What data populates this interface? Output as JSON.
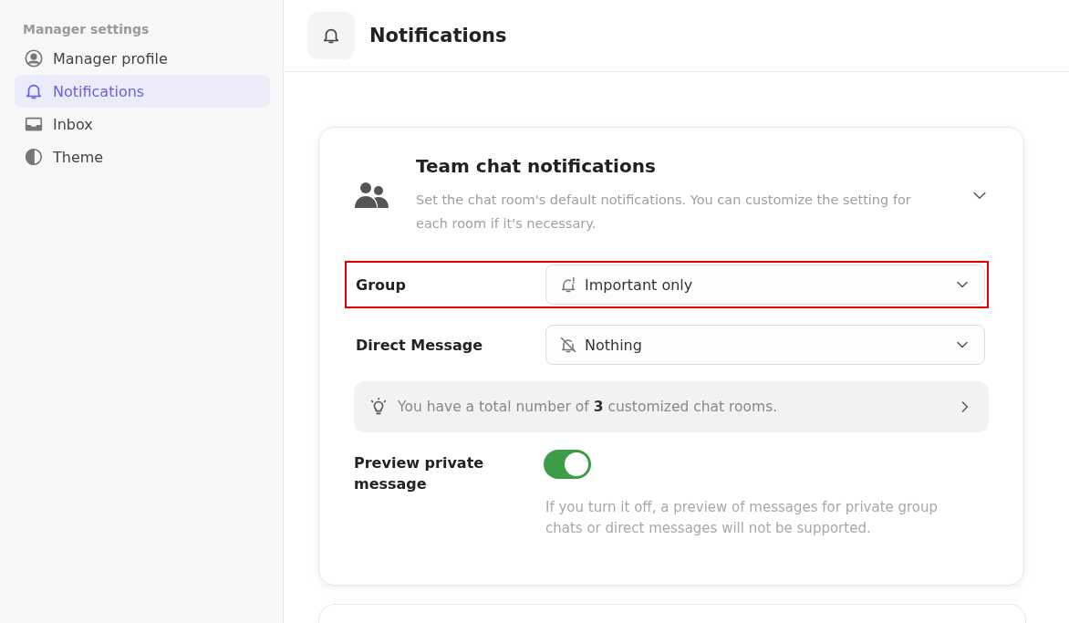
{
  "sidebar": {
    "heading": "Manager settings",
    "items": [
      {
        "label": "Manager profile",
        "kind": "profile",
        "selected": false
      },
      {
        "label": "Notifications",
        "kind": "bell",
        "selected": true
      },
      {
        "label": "Inbox",
        "kind": "inbox",
        "selected": false
      },
      {
        "label": "Theme",
        "kind": "theme",
        "selected": false
      }
    ]
  },
  "header": {
    "title": "Notifications"
  },
  "card": {
    "title": "Team chat notifications",
    "description": "Set the chat room's default notifications. You can customize the setting for each room if it's necessary.",
    "expanded": true,
    "selects": [
      {
        "label": "Group",
        "value": "Important only",
        "kind": "important",
        "highlighted": true
      },
      {
        "label": "Direct Message",
        "value": "Nothing",
        "kind": "muted",
        "highlighted": false
      }
    ],
    "info": "You have a total number of **3** customized chat rooms.",
    "toggle": {
      "label": "Preview private message",
      "on": true,
      "hint": "If you turn it off, a preview of messages for private group chats or direct messages will not be supported."
    }
  }
}
